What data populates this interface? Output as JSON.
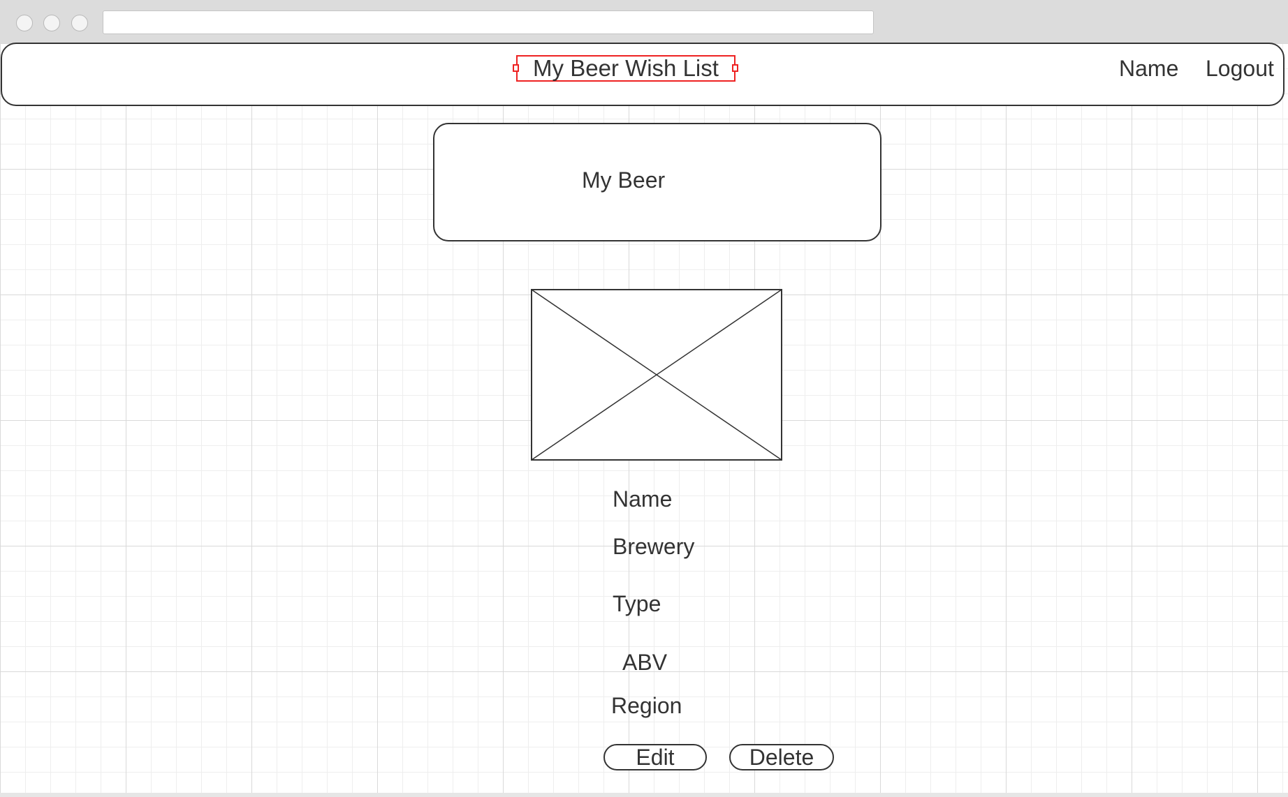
{
  "navbar": {
    "title": "My Beer Wish List",
    "name_link": "Name",
    "logout_link": "Logout"
  },
  "page_header": {
    "label": "My Beer"
  },
  "beer_details": {
    "name": "Name",
    "brewery": "Brewery",
    "type": "Type",
    "abv": "ABV",
    "region": "Region"
  },
  "actions": {
    "edit_label": "Edit",
    "delete_label": "Delete"
  },
  "icons": {
    "image_placeholder": "image-placeholder-icon"
  },
  "colors": {
    "selection": "#ee2222",
    "outline": "#333333",
    "grid": "#d9d9d9"
  }
}
